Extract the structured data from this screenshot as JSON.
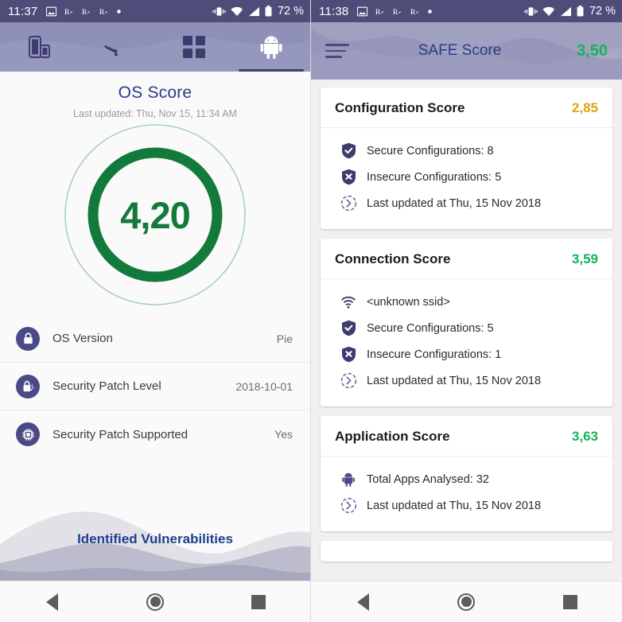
{
  "left": {
    "statusbar": {
      "time": "11:37",
      "battery": "72 %",
      "icons": [
        "image-icon",
        "roaming-icon",
        "roaming-icon",
        "roaming-icon",
        "dot-icon",
        "vibrate-icon",
        "wifi-icon",
        "signal-icon",
        "battery-icon"
      ]
    },
    "tabs": [
      {
        "name": "tab-devices",
        "icon": "devices-icon",
        "active": false
      },
      {
        "name": "tab-wifi",
        "icon": "wifi-icon",
        "active": false
      },
      {
        "name": "tab-apps",
        "icon": "grid-icon",
        "active": false
      },
      {
        "name": "tab-android",
        "icon": "android-icon",
        "active": true
      }
    ],
    "title": "OS Score",
    "subtitle": "Last updated: Thu, Nov 15, 11:34 AM",
    "gauge_value": "4,20",
    "rows": [
      {
        "icon": "lock-icon",
        "label": "OS Version",
        "value": "Pie"
      },
      {
        "icon": "lock-patch-icon",
        "label": "Security Patch Level",
        "value": "2018-10-01"
      },
      {
        "icon": "chip-icon",
        "label": "Security Patch Supported",
        "value": "Yes"
      }
    ],
    "waves_label": "Identified Vulnerabilities"
  },
  "right": {
    "statusbar": {
      "time": "11:38",
      "battery": "72 %"
    },
    "appbar": {
      "menu_icon": "hamburger-icon",
      "title": "SAFE Score",
      "score": "3,50"
    },
    "cards": [
      {
        "title": "Configuration Score",
        "score": "2,85",
        "score_color": "#e0a316",
        "items": [
          {
            "icon": "shield-check-icon",
            "text": "Secure Configurations: 8"
          },
          {
            "icon": "shield-x-icon",
            "text": "Insecure Configurations: 5"
          },
          {
            "icon": "clock-history-icon",
            "text": "Last updated at Thu, 15 Nov 2018"
          }
        ]
      },
      {
        "title": "Connection Score",
        "score": "3,59",
        "score_color": "#14b35a",
        "items": [
          {
            "icon": "wifi-icon",
            "text": "<unknown ssid>"
          },
          {
            "icon": "shield-check-icon",
            "text": "Secure Configurations: 5"
          },
          {
            "icon": "shield-x-icon",
            "text": "Insecure Configurations: 1"
          },
          {
            "icon": "clock-history-icon",
            "text": "Last updated at Thu, 15 Nov 2018"
          }
        ]
      },
      {
        "title": "Application Score",
        "score": "3,63",
        "score_color": "#14b35a",
        "items": [
          {
            "icon": "android-icon",
            "text": "Total Apps Analysed: 32"
          },
          {
            "icon": "clock-history-icon",
            "text": "Last updated at Thu, 15 Nov 2018"
          }
        ]
      }
    ]
  },
  "navbar": {
    "back": "back-icon",
    "home": "home-icon",
    "recents": "recents-icon"
  },
  "colors": {
    "statusbar": "#4e4d7a",
    "tabbar": "#8f90b8",
    "appbar": "#9a9bbd",
    "green": "#14b35a",
    "gauge_green": "#127a3b",
    "amber": "#e0a316",
    "title_blue": "#2a3d85",
    "icon_purple": "#4b4a87"
  }
}
